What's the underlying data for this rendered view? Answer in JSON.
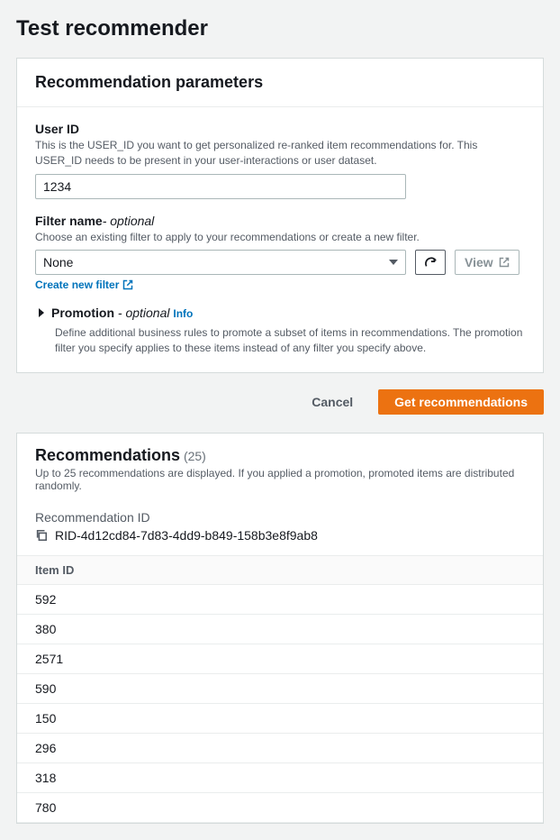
{
  "page": {
    "title": "Test recommender"
  },
  "params": {
    "heading": "Recommendation parameters",
    "user_id": {
      "label": "User ID",
      "description": "This is the USER_ID you want to get personalized re-ranked item recommendations for. This USER_ID needs to be present in your user-interactions or user dataset.",
      "value": "1234"
    },
    "filter": {
      "label_prefix": "Filter name",
      "optional": "- optional",
      "description": "Choose an existing filter to apply to your recommendations or create a new filter.",
      "selected": "None",
      "view_label": "View",
      "create_link": "Create new filter"
    },
    "promotion": {
      "label_prefix": "Promotion ",
      "optional": "- optional",
      "info": "Info",
      "description": "Define additional business rules to promote a subset of items in recommendations. The promotion filter you specify applies to these items instead of any filter you specify above."
    }
  },
  "actions": {
    "cancel": "Cancel",
    "submit": "Get recommendations"
  },
  "results": {
    "heading": "Recommendations",
    "count_display": "(25)",
    "subtitle": "Up to 25 recommendations are displayed. If you applied a promotion, promoted items are distributed randomly.",
    "rec_id_label": "Recommendation ID",
    "rec_id_value": "RID-4d12cd84-7d83-4dd9-b849-158b3e8f9ab8",
    "column_header": "Item ID",
    "items": [
      "592",
      "380",
      "2571",
      "590",
      "150",
      "296",
      "318",
      "780"
    ]
  }
}
